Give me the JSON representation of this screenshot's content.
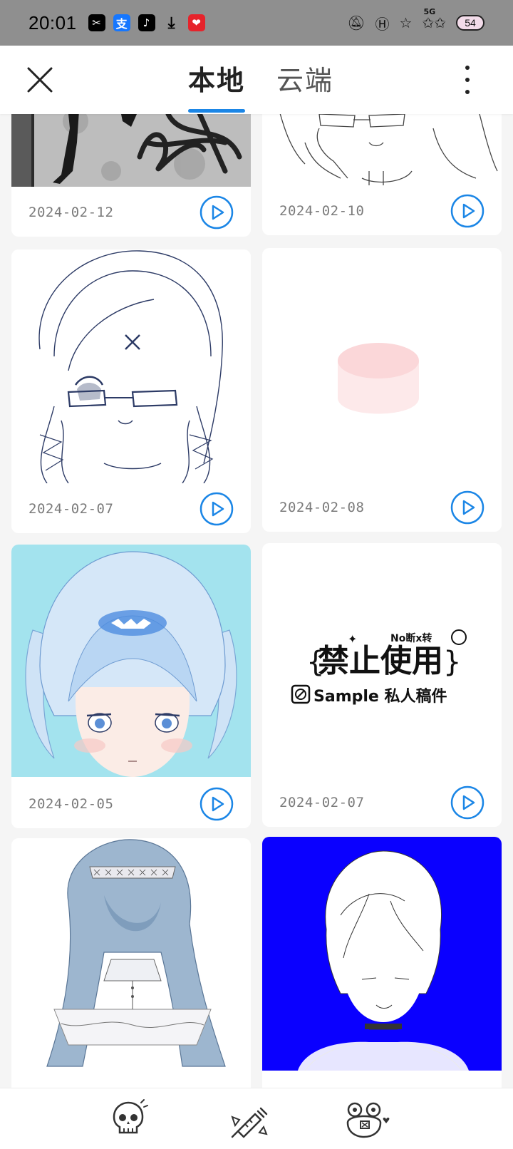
{
  "status_bar": {
    "time": "20:01",
    "apps": [
      {
        "icon": "capcut-icon",
        "glyph": "✂"
      },
      {
        "icon": "alipay-icon",
        "glyph": "支"
      },
      {
        "icon": "tiktok-icon",
        "glyph": "♪"
      },
      {
        "icon": "download-icon",
        "glyph": "⤓"
      },
      {
        "icon": "xiaohongshu-icon",
        "glyph": "❤"
      }
    ],
    "network_label": "5G",
    "battery_level": "54"
  },
  "header": {
    "tabs": [
      {
        "label": "本地",
        "active": true
      },
      {
        "label": "云端",
        "active": false
      }
    ]
  },
  "gallery": {
    "items": [
      {
        "date": "2024-02-12",
        "art": "graffiti-photo"
      },
      {
        "date": "2024-02-10",
        "art": "sketch-girl-glasses"
      },
      {
        "date": "2024-02-07",
        "art": "sketch-girl-braids"
      },
      {
        "date": "2024-02-08",
        "art": "pink-cylinder"
      },
      {
        "date": "2024-02-05",
        "art": "blue-hair-girl"
      },
      {
        "date": "2024-02-07",
        "art": "watermark-sample"
      },
      {
        "date": "",
        "art": "lace-dress-girl"
      },
      {
        "date": "",
        "art": "blue-bg-short-hair-girl"
      }
    ],
    "watermark": {
      "line1": "禁止使用",
      "line2": "Sample 私人稿件",
      "tag": "No断x转"
    }
  },
  "bottom_bar": {
    "icons": [
      "skull-icon",
      "syringe-icon",
      "frog-icon"
    ]
  },
  "colors": {
    "accent": "#1b86e6",
    "status_bar": "#8f8f8f",
    "background": "#f5f5f5",
    "blue_background_art": "#0a00ff",
    "cyan_background_art": "#a3e3ee"
  }
}
